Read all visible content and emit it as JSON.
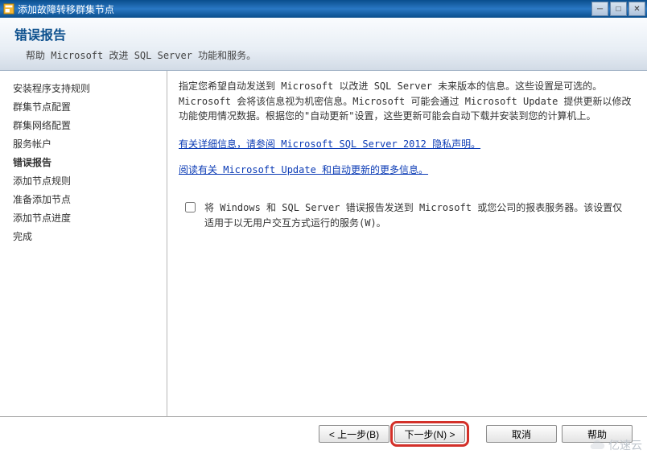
{
  "window": {
    "title": "添加故障转移群集节点"
  },
  "header": {
    "title": "错误报告",
    "subtitle": "帮助 Microsoft 改进 SQL Server 功能和服务。"
  },
  "sidebar": {
    "items": [
      {
        "label": "安装程序支持规则"
      },
      {
        "label": "群集节点配置"
      },
      {
        "label": "群集网络配置"
      },
      {
        "label": "服务帐户"
      },
      {
        "label": "错误报告",
        "active": true
      },
      {
        "label": "添加节点规则"
      },
      {
        "label": "准备添加节点"
      },
      {
        "label": "添加节点进度"
      },
      {
        "label": "完成"
      }
    ]
  },
  "content": {
    "paragraph": "指定您希望自动发送到 Microsoft 以改进 SQL Server 未来版本的信息。这些设置是可选的。Microsoft 会将该信息视为机密信息。Microsoft 可能会通过 Microsoft Update 提供更新以修改功能使用情况数据。根据您的\"自动更新\"设置，这些更新可能会自动下载并安装到您的计算机上。",
    "link1": "有关详细信息，请参阅 Microsoft SQL Server 2012 隐私声明。",
    "link2": "阅读有关 Microsoft Update 和自动更新的更多信息。",
    "checkbox_label": "将 Windows 和 SQL Server 错误报告发送到 Microsoft 或您公司的报表服务器。该设置仅适用于以无用户交互方式运行的服务(W)。",
    "checkbox_checked": false
  },
  "footer": {
    "back": "< 上一步(B)",
    "next": "下一步(N) >",
    "cancel": "取消",
    "help": "帮助"
  },
  "watermark": "亿速云"
}
